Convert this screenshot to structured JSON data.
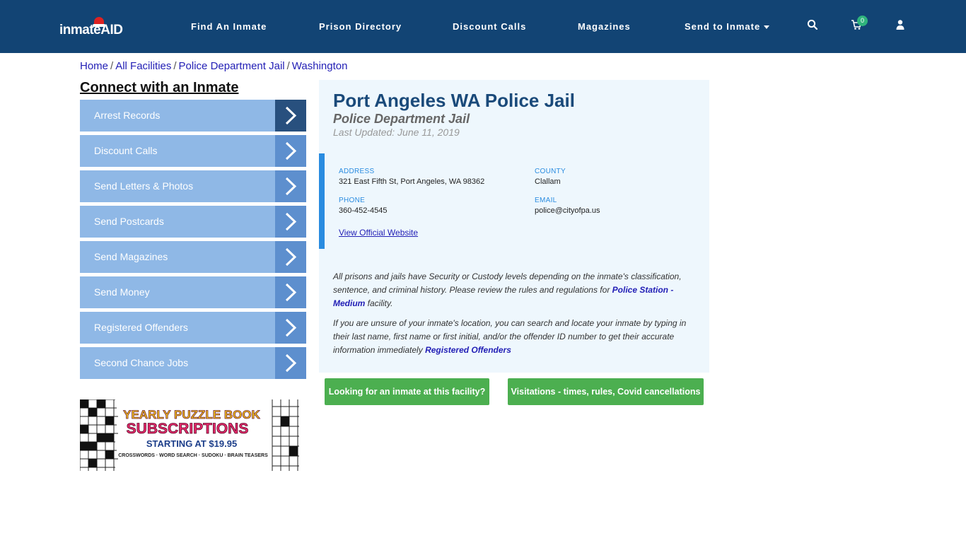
{
  "header": {
    "logo_text": "inmateAID",
    "nav": [
      {
        "label": "Find An Inmate"
      },
      {
        "label": "Prison Directory"
      },
      {
        "label": "Discount Calls"
      },
      {
        "label": "Magazines"
      },
      {
        "label": "Send to Inmate"
      }
    ],
    "cart_count": "0",
    "icons": [
      "search-icon",
      "cart-icon",
      "user-icon"
    ]
  },
  "breadcrumb": [
    "Home",
    "All Facilities",
    "Police Department Jail",
    "Washington"
  ],
  "sidebar": {
    "title": "Connect with an Inmate",
    "items": [
      {
        "label": "Arrest Records"
      },
      {
        "label": "Discount Calls"
      },
      {
        "label": "Send Letters & Photos"
      },
      {
        "label": "Send Postcards"
      },
      {
        "label": "Send Magazines"
      },
      {
        "label": "Send Money"
      },
      {
        "label": "Registered Offenders"
      },
      {
        "label": "Second Chance Jobs"
      }
    ],
    "ad": {
      "line1": "YEARLY PUZZLE BOOK",
      "line2": "SUBSCRIPTIONS",
      "line3": "STARTING AT $19.95",
      "line4": "CROSSWORDS · WORD SEARCH · SUDOKU · BRAIN TEASERS"
    }
  },
  "facility": {
    "title": "Port Angeles WA Police Jail",
    "type": "Police Department Jail",
    "updated": "Last Updated: June 11, 2019",
    "address_label": "ADDRESS",
    "address": "321 East Fifth St, Port Angeles, WA 98362",
    "county_label": "COUNTY",
    "county": "Clallam",
    "phone_label": "PHONE",
    "phone": "360-452-4545",
    "email_label": "EMAIL",
    "email": "police@cityofpa.us",
    "website_link": "View Official Website",
    "para1_a": "All prisons and jails have Security or Custody levels depending on the inmate's classification, sentence, and criminal history. Please review the rules and regulations for ",
    "para1_link": "Police Station - Medium",
    "para1_b": " facility.",
    "para2_a": "If you are unsure of your inmate's location, you can search and locate your inmate by typing in their last name, first name or first initial, and/or the offender ID number to get their accurate information immediately ",
    "para2_link": "Registered Offenders"
  },
  "buttons": {
    "looking": "Looking for an inmate at this facility?",
    "visitations": "Visitations - times, rules, Covid cancellations"
  },
  "colors": {
    "header_bg": "#124474",
    "sidebar_item": "#8fb8e6",
    "sidebar_arrow": "#5d8fce",
    "sidebar_arrow_active": "#28507e",
    "card_bg": "#eef7fd",
    "accent_blue": "#2a8ce0",
    "green_button": "#4caf50"
  }
}
